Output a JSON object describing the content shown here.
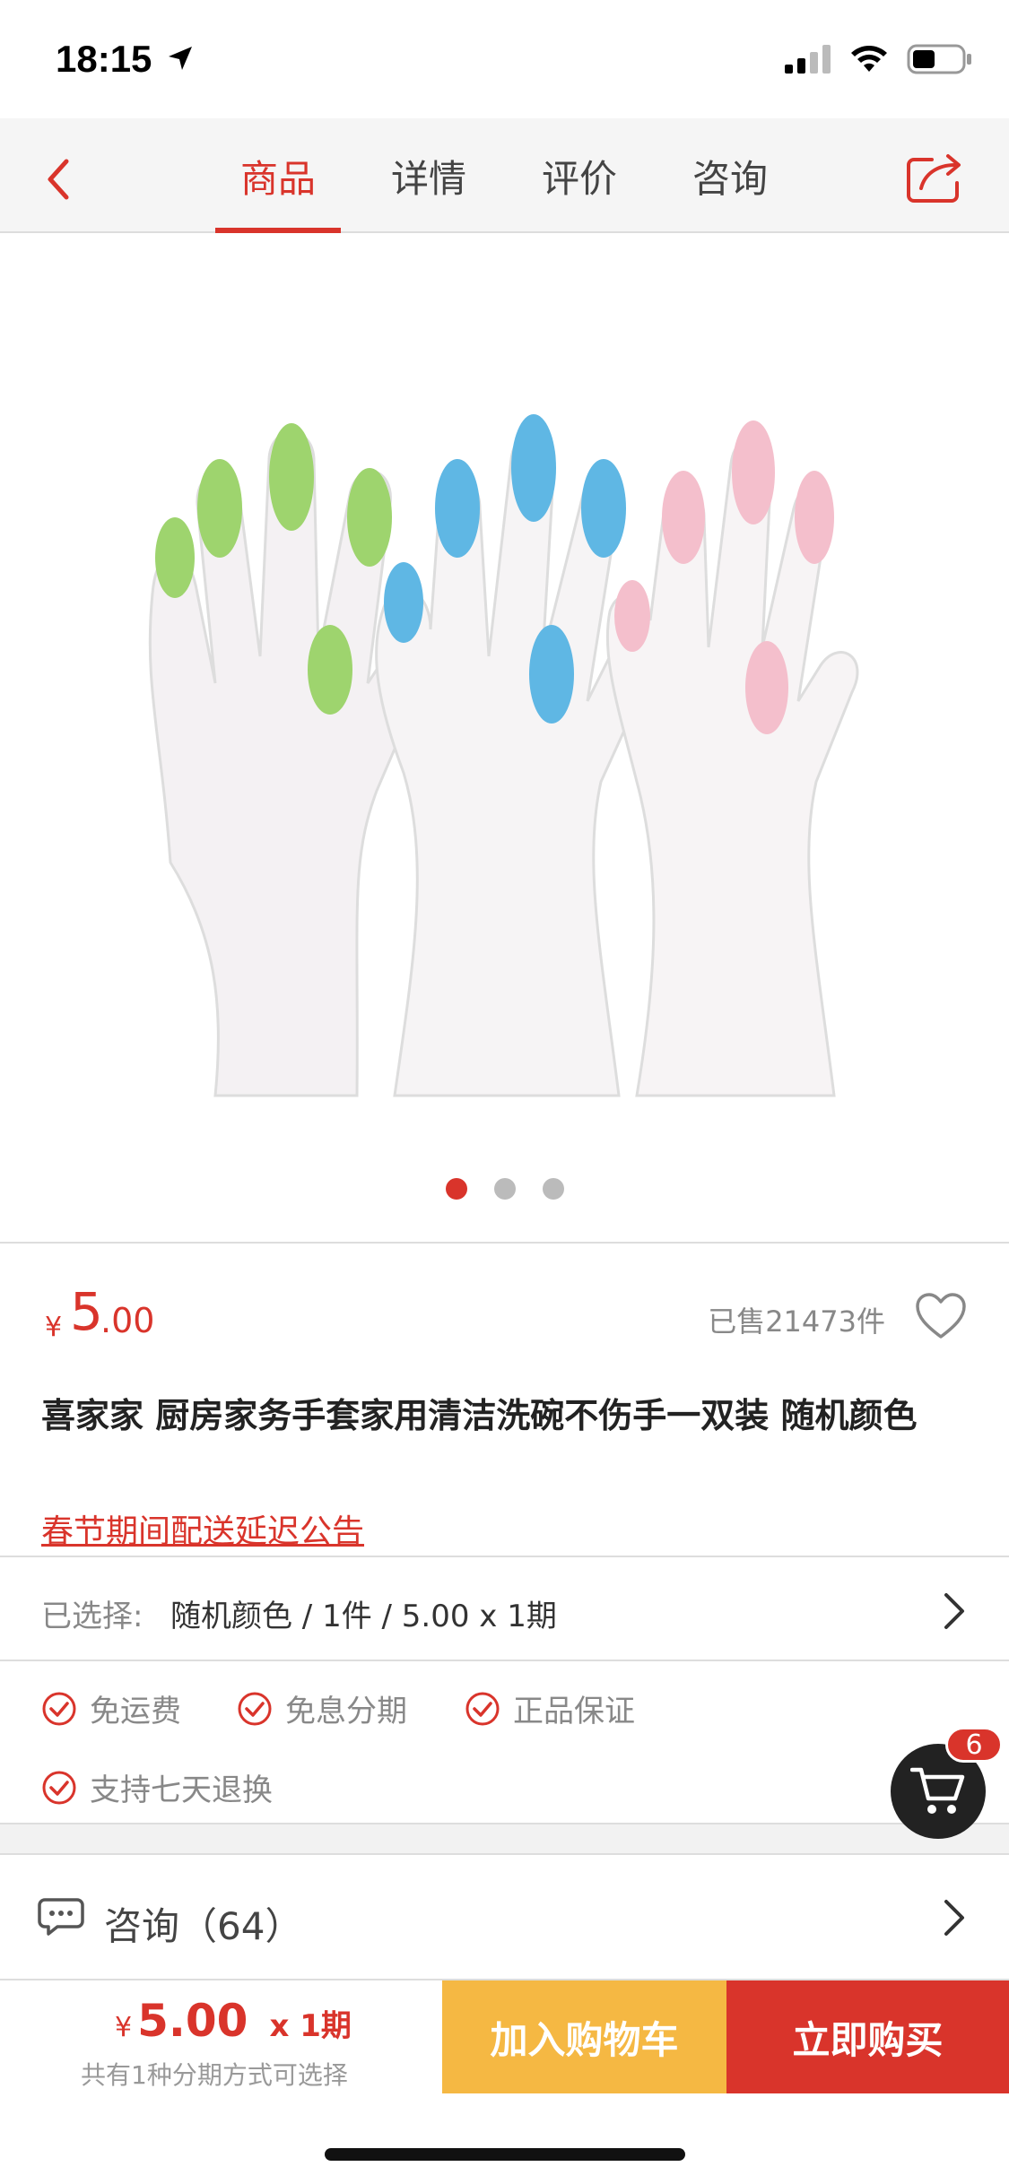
{
  "status_bar": {
    "time": "18:15"
  },
  "nav": {
    "tabs": [
      {
        "label": "商品",
        "active": true
      },
      {
        "label": "详情",
        "active": false
      },
      {
        "label": "评价",
        "active": false
      },
      {
        "label": "咨询",
        "active": false
      }
    ],
    "icons": {
      "back": "chevron-left-icon",
      "share": "share-icon"
    }
  },
  "gallery": {
    "image_count": 3,
    "active_index": 0
  },
  "product": {
    "currency": "¥",
    "price_int": "5",
    "price_dec": ".00",
    "sold": "已售21473件",
    "title": "喜家家 厨房家务手套家用清洁洗碗不伤手一双装 随机颜色",
    "notice": "春节期间配送延迟公告"
  },
  "selection": {
    "label": "已选择:",
    "value": "随机颜色 / 1件 / 5.00 x 1期"
  },
  "guarantees": [
    "免运费",
    "免息分期",
    "正品保证",
    "支持七天退换"
  ],
  "consult": {
    "label": "咨询（64）"
  },
  "cart": {
    "badge": "6"
  },
  "bottom": {
    "currency": "¥",
    "price": "5.00",
    "periods": "x 1期",
    "sub": "共有1种分期方式可选择",
    "add_to_cart": "加入购物车",
    "buy_now": "立即购买"
  },
  "colors": {
    "accent": "#d9342b",
    "cart_button": "#f5b843"
  }
}
